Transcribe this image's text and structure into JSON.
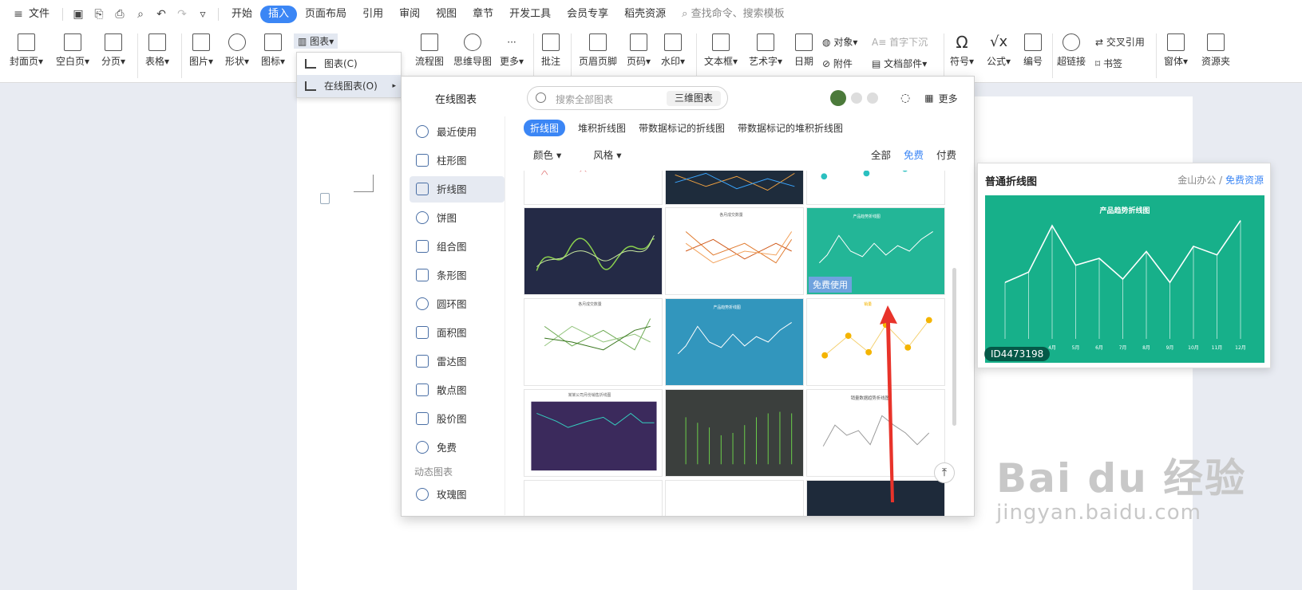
{
  "menubar": {
    "file": "文件",
    "tabs": [
      "开始",
      "插入",
      "页面布局",
      "引用",
      "审阅",
      "视图",
      "章节",
      "开发工具",
      "会员专享",
      "稻壳资源"
    ],
    "active_tab": "插入",
    "search": "查找命令、搜索模板"
  },
  "ribbon": {
    "big": [
      "封面页",
      "空白页",
      "分页",
      "表格",
      "图片",
      "形状",
      "图标",
      "流程图",
      "思维导图",
      "更多",
      "批注",
      "页眉页脚",
      "页码",
      "水印",
      "文本框",
      "艺术字",
      "日期",
      "符号",
      "公式",
      "编号",
      "超链接",
      "窗体",
      "资源夹"
    ],
    "chart_btn": "图表",
    "obj": "对象",
    "dropcap": "首字下沉",
    "attach": "附件",
    "docpart": "文档部件",
    "crossref": "交叉引用",
    "bookmark": "书签"
  },
  "dropmenu": {
    "item1": "图表(C)",
    "item2": "在线图表(O)"
  },
  "panel": {
    "title": "在线图表",
    "search_placeholder": "搜索全部图表",
    "btn3d": "三维图表",
    "more": "更多",
    "categories": [
      "最近使用",
      "柱形图",
      "折线图",
      "饼图",
      "组合图",
      "条形图",
      "圆环图",
      "面积图",
      "雷达图",
      "散点图",
      "股价图",
      "免费"
    ],
    "dynamic_label": "动态图表",
    "rose": "玫瑰图",
    "subtabs": [
      "折线图",
      "堆积折线图",
      "带数据标记的折线图",
      "带数据标记的堆积折线图"
    ],
    "filter_color": "颜色",
    "filter_style": "风格",
    "pricing": [
      "全部",
      "免费",
      "付费"
    ],
    "free_badge": "免费使用",
    "thumb_titles": [
      "各月成交数量",
      "产品趋势折线图",
      "各月成交数量",
      "产品趋势折线图",
      "销量",
      "某某公司月份销售折线图",
      "销量数据趋势折线图"
    ]
  },
  "preview": {
    "title": "普通折线图",
    "source": "金山办公",
    "sep": "/",
    "free": "免费资源",
    "id": "ID4473198",
    "chart_data": {
      "type": "line",
      "title": "产品趋势折线图",
      "categories": [
        "4月",
        "5月",
        "6月",
        "7月",
        "8月",
        "9月",
        "10月",
        "11月",
        "12月"
      ],
      "series": [
        {
          "values": [
            42,
            48,
            75,
            52,
            56,
            44,
            60,
            42,
            63,
            58,
            78
          ]
        }
      ]
    },
    "color": "#17b08a"
  },
  "watermark": {
    "line1": "Bai du 经验",
    "line2": "jingyan.baidu.com"
  }
}
